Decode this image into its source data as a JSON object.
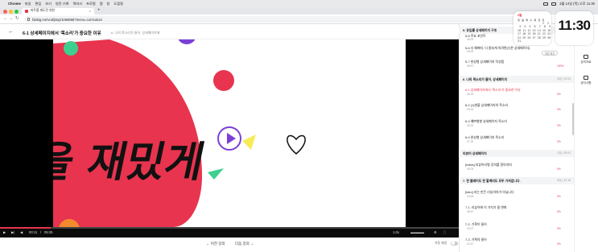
{
  "menubar": {
    "apple": "",
    "app": "Chrome",
    "items": [
      "파일",
      "편집",
      "보기",
      "방문 기록",
      "북마크",
      "프로필",
      "탭",
      "창",
      "도움말"
    ],
    "datetime": "3월 14일 (목) 오후 11:30"
  },
  "browser": {
    "tab_title": "파트를 재도전 위한",
    "url": "fabkig.me/vod/play/1066868?menu=curriculum"
  },
  "header": {
    "title": "6-1 상세페이지에서 '목소리'가 중요한 이유",
    "subtitle": "6. 나의 목소리가 들어, 상세페이지에"
  },
  "video": {
    "overlay_text": "을 재밌게",
    "progress_fraction": 0.11,
    "time_current": "00:11",
    "time_total": "05:25",
    "speed": "1.0x",
    "colors": {
      "accent": "#e8344e",
      "green": "#3ecf8e",
      "purple": "#7b3fd6",
      "yellow": "#f6ec5a",
      "orange": "#f28a2e"
    }
  },
  "bottom": {
    "prev": "← 이전 강의",
    "next": "다음 강의 →",
    "autoplay": "자동 재생"
  },
  "sidebar": {
    "tip": "이어 보기",
    "sections": [
      {
        "title": "5. 유입률 상세페이지 구조",
        "meta": ""
      },
      {
        "title": "6. 나의 목소리가 들어, 상세페이지",
        "meta": "4강 | 20:03"
      },
      {
        "title": "리뷰어 상세페이지",
        "meta": "1강 | 05:03"
      },
      {
        "title": "7. 한 클레어도 한 할께리도 모두 가져갑니다.",
        "meta": "6강 | 42:18"
      }
    ],
    "lectures": [
      {
        "title": "5-5 주요 포인트",
        "meta": "06:02",
        "progress": ""
      },
      {
        "title": "5-6 더 예뻐지, 더 잘되게 하려면(다른 상세페이지)",
        "meta": "06:29",
        "progress": ""
      },
      {
        "title": "5-7 완성형 상세페이지 작성법",
        "meta": "08:57",
        "progress": "100%"
      },
      {
        "title": "6-1 상세페이지에서 '목소리'가 중요한 이유",
        "meta": "05:25",
        "progress": "0%"
      },
      {
        "title": "6-2 (1)현황 상세페이지의 목소리",
        "meta": "03:53",
        "progress": "0%"
      },
      {
        "title": "6-3 예쁘형형 상세페이지 목소리",
        "meta": "05:19",
        "progress": "0%"
      },
      {
        "title": "6-4 완성형 상세페이지 목소리",
        "meta": "07:18",
        "progress": "0%"
      },
      {
        "title": "[notes] 리뷰어리형 강의를 알아야지",
        "meta": "05:03",
        "progress": "0%"
      },
      {
        "title": "[intro] 지는 만든 리뷰어야가 아닙니다",
        "meta": "04:28",
        "progress": "0%"
      },
      {
        "title": "7-1. 리뷰어에 이 가치가 될 변화",
        "meta": "08:57",
        "progress": "0%"
      },
      {
        "title": "7-2. 기획이 들어",
        "meta": "03:07",
        "progress": "0%"
      },
      {
        "title": "7-3. 기획의 들어",
        "meta": "11:02",
        "progress": "0%"
      }
    ]
  },
  "rail": {
    "items": [
      "강의자료",
      "공지사항"
    ]
  },
  "widgets": {
    "calendar_month": "3월",
    "calendar_rows": [
      "일 월 화 수 목 금 토",
      "               1  2",
      " 3  4  5  6  7  8  9",
      "10 11 12 13 14 15 16",
      "17 18 19 20 21 22 23",
      "24 25 26 27 28 29 30",
      "31"
    ],
    "clock": "11:30"
  }
}
